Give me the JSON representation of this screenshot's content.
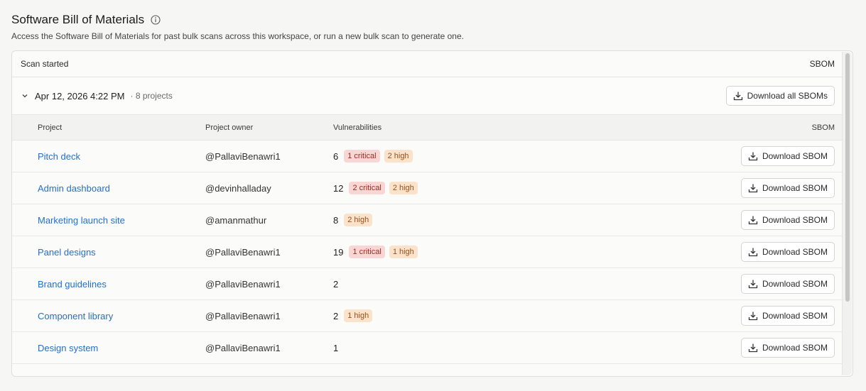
{
  "header": {
    "title": "Software Bill of Materials",
    "subtitle": "Access the Software Bill of Materials for past bulk scans across this workspace, or run a new bulk scan to generate one."
  },
  "table": {
    "col_scan_started": "Scan started",
    "col_sbom": "SBOM"
  },
  "group": {
    "date": "Apr 12, 2026 4:22 PM",
    "count": "· 8 projects",
    "download_all_label": "Download all SBOMs"
  },
  "columns": {
    "project": "Project",
    "owner": "Project owner",
    "vulnerabilities": "Vulnerabilities",
    "sbom": "SBOM"
  },
  "rows": [
    {
      "project": "Pitch deck",
      "owner": "@PallaviBenawri1",
      "count": "6",
      "critical": "1 critical",
      "high": "2 high",
      "download": "Download SBOM"
    },
    {
      "project": "Admin dashboard",
      "owner": "@devinhalladay",
      "count": "12",
      "critical": "2 critical",
      "high": "2 high",
      "download": "Download SBOM"
    },
    {
      "project": "Marketing launch site",
      "owner": "@amanmathur",
      "count": "8",
      "critical": "",
      "high": "2 high",
      "download": "Download SBOM"
    },
    {
      "project": "Panel designs",
      "owner": "@PallaviBenawri1",
      "count": "19",
      "critical": "1 critical",
      "high": "1 high",
      "download": "Download SBOM"
    },
    {
      "project": "Brand guidelines",
      "owner": "@PallaviBenawri1",
      "count": "2",
      "critical": "",
      "high": "",
      "download": "Download SBOM"
    },
    {
      "project": "Component library",
      "owner": "@PallaviBenawri1",
      "count": "2",
      "critical": "",
      "high": "1 high",
      "download": "Download SBOM"
    },
    {
      "project": "Design system",
      "owner": "@PallaviBenawri1",
      "count": "1",
      "critical": "",
      "high": "",
      "download": "Download SBOM"
    }
  ],
  "icons": {
    "info": "info-icon",
    "chevron": "chevron-down-icon",
    "download": "download-icon"
  },
  "colors": {
    "link": "#2470c7",
    "critical_bg": "#f7d6d3",
    "high_bg": "#fbe3cb"
  }
}
